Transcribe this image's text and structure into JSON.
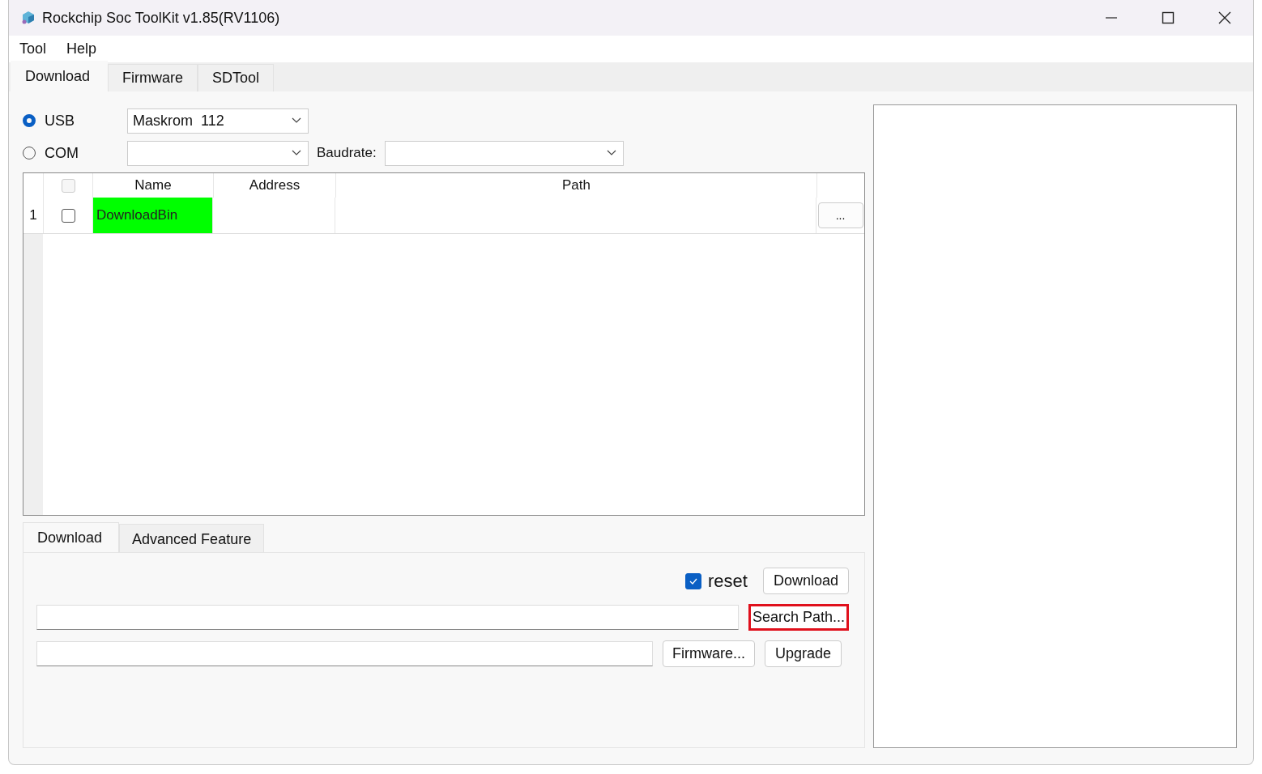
{
  "window": {
    "title": "Rockchip Soc ToolKit v1.85(RV1106)"
  },
  "menu": [
    "Tool",
    "Help"
  ],
  "tabs": [
    {
      "label": "Download",
      "selected": true
    },
    {
      "label": "Firmware",
      "selected": false
    },
    {
      "label": "SDTool",
      "selected": false
    }
  ],
  "connection": [
    {
      "label": "USB",
      "selected": true,
      "device": "Maskrom  112"
    },
    {
      "label": "COM",
      "selected": false
    }
  ],
  "baudrate": {
    "label": "Baudrate:"
  },
  "table": {
    "columns": [
      "Name",
      "Address",
      "Path"
    ],
    "header_checked": false,
    "rows": [
      {
        "index": "1",
        "checked": false,
        "name": "DownloadBin",
        "highlighted": true,
        "browse": "..."
      }
    ]
  },
  "sub_tabs": [
    {
      "label": "Download",
      "selected": true
    },
    {
      "label": "Advanced Feature",
      "selected": false
    }
  ],
  "reset": {
    "label": "reset",
    "checked": true
  },
  "buttons": {
    "download": {
      "label": "Download",
      "highlighted": false
    },
    "search": {
      "label": "Search Path...",
      "highlighted": true
    },
    "firmware": {
      "label": "Firmware...",
      "highlighted": false
    },
    "upgrade": {
      "label": "Upgrade",
      "highlighted": false
    }
  }
}
